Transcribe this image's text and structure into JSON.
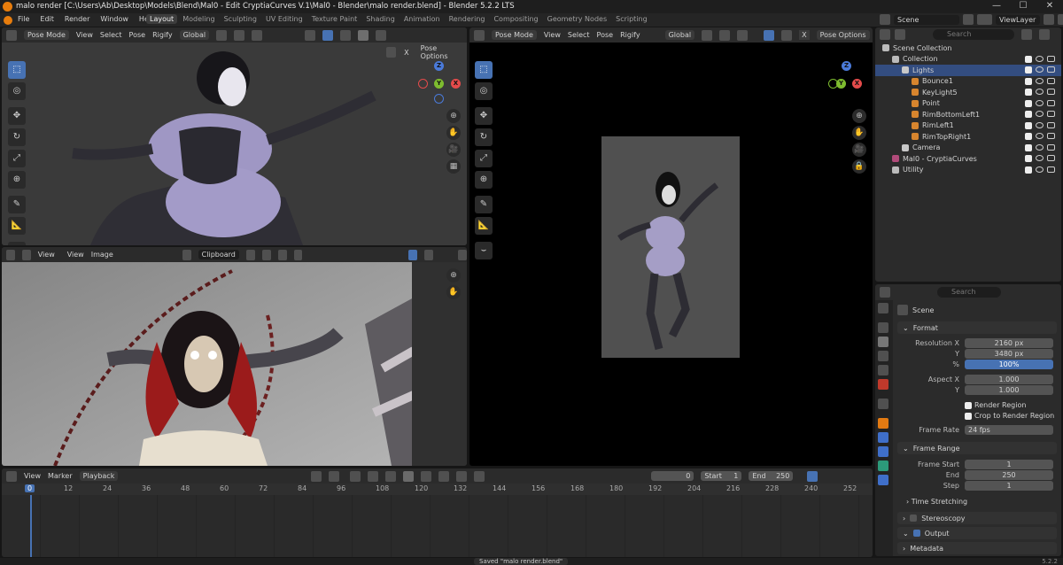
{
  "titlebar": {
    "title": "malo render [C:\\Users\\Ab\\Desktop\\Models\\Blend\\Mal0 - Edit CryptiaCurves V.1\\Mal0 - Blender\\malo render.blend] - Blender 5.2.2 LTS",
    "minimize": "—",
    "maximize": "☐",
    "close": "✕"
  },
  "menu": [
    "File",
    "Edit",
    "Render",
    "Window",
    "Help"
  ],
  "workspaces": [
    {
      "label": "Layout",
      "active": true
    },
    {
      "label": "Modeling"
    },
    {
      "label": "Sculpting"
    },
    {
      "label": "UV Editing"
    },
    {
      "label": "Texture Paint"
    },
    {
      "label": "Shading"
    },
    {
      "label": "Animation"
    },
    {
      "label": "Rendering"
    },
    {
      "label": "Compositing"
    },
    {
      "label": "Geometry Nodes"
    },
    {
      "label": "Scripting"
    }
  ],
  "scene_selector": {
    "label": "Scene"
  },
  "viewlayer": {
    "label": "ViewLayer"
  },
  "vp1": {
    "mode": "Pose Mode",
    "menus": [
      "View",
      "Select",
      "Pose",
      "Rigify"
    ],
    "orientation": "Global",
    "pose_options": "Pose Options",
    "x_label": "X"
  },
  "vp2": {
    "mode": "Pose Mode",
    "menus": [
      "View",
      "Select",
      "Pose",
      "Rigify"
    ],
    "orientation": "Global",
    "pose_options": "Pose Options",
    "x_label": "X"
  },
  "img": {
    "view": "View",
    "menus": [
      "View",
      "Image"
    ],
    "image_name": "Clipboard"
  },
  "outliner": {
    "search_placeholder": "Search",
    "rows": [
      {
        "label": "Scene Collection",
        "level": 0
      },
      {
        "label": "Collection",
        "level": 1
      },
      {
        "label": "Lights",
        "level": 2
      },
      {
        "label": "Bounce1",
        "level": 3
      },
      {
        "label": "KeyLight5",
        "level": 3
      },
      {
        "label": "Point",
        "level": 3
      },
      {
        "label": "RimBottomLeft1",
        "level": 3
      },
      {
        "label": "RimLeft1",
        "level": 3
      },
      {
        "label": "RimTopRight1",
        "level": 3
      },
      {
        "label": "Camera",
        "level": 2
      },
      {
        "label": "Mal0 - CryptiaCurves",
        "level": 1
      },
      {
        "label": "Utility",
        "level": 1
      }
    ]
  },
  "properties": {
    "search_placeholder": "Search",
    "scene_label": "Scene",
    "format": {
      "title": "Format",
      "res_x_label": "Resolution X",
      "res_x": "2160 px",
      "res_y_label": "Y",
      "res_y": "3480 px",
      "pct_label": "%",
      "pct": "100%",
      "aspect_x_label": "Aspect X",
      "aspect_x": "1.000",
      "aspect_y_label": "Y",
      "aspect_y": "1.000",
      "render_region": "Render Region",
      "crop": "Crop to Render Region",
      "frame_rate_label": "Frame Rate",
      "frame_rate": "24 fps"
    },
    "frame_range": {
      "title": "Frame Range",
      "start_label": "Frame Start",
      "start": "1",
      "end_label": "End",
      "end": "250",
      "step_label": "Step",
      "step": "1",
      "time_stretching": "Time Stretching"
    },
    "stereoscopy": "Stereoscopy",
    "output": "Output",
    "metadata": "Metadata"
  },
  "timeline": {
    "menus": [
      "View",
      "Marker",
      "Playback"
    ],
    "current_frame": "0",
    "start_label": "Start",
    "start": "1",
    "end_label": "End",
    "end": "250",
    "ticks": [
      "0",
      "12",
      "24",
      "36",
      "48",
      "60",
      "72",
      "84",
      "96",
      "108",
      "120",
      "132",
      "144",
      "156",
      "168",
      "180",
      "192",
      "204",
      "216",
      "228",
      "240",
      "252"
    ]
  },
  "status": {
    "message": "Saved \"malo render.blend\"",
    "version": "5.2.2"
  }
}
